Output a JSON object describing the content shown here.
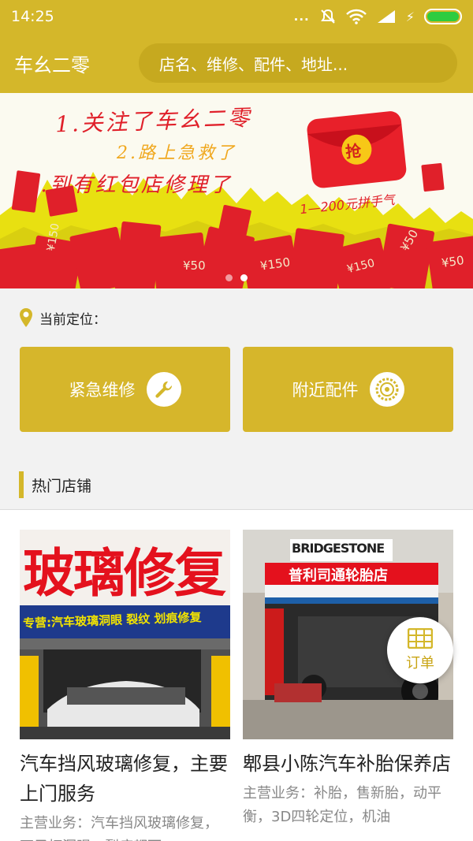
{
  "status_bar": {
    "time": "14:25",
    "dots": "..."
  },
  "header": {
    "title": "车幺二零",
    "search_placeholder": "店名、维修、配件、地址..."
  },
  "banner": {
    "lines": [
      "1.关注了车幺二零",
      "2.路上急救了",
      "3.到有红包店修理了"
    ],
    "envelope_text": "抢",
    "range_text": "1—200元拼手气",
    "envelope_labels": [
      "¥150",
      "¥50",
      "¥150",
      "¥50",
      "¥150",
      "¥50"
    ],
    "slides": 2,
    "active_slide": 1
  },
  "location": {
    "label": "当前定位："
  },
  "quick_actions": [
    {
      "label": "紧急维修",
      "icon": "wrench-icon"
    },
    {
      "label": "附近配件",
      "icon": "tire-icon"
    }
  ],
  "section": {
    "title": "热门店铺"
  },
  "shops": [
    {
      "name": "汽车挡风玻璃修复，主要上门服务",
      "desc": "主营业务：汽车挡风玻璃修复，石子打洞眼，裂痕都可",
      "sign_main": "玻璃修复",
      "sign_sub": "专营:汽车玻璃洞眼 裂纹 划痕修复"
    },
    {
      "name": "郫县小陈汽车补胎保养店",
      "desc": "主营业务：补胎，售新胎，动平衡，3D四轮定位，机油",
      "sign_brand": "BRIDGESTONE",
      "sign_store": "普利司通轮胎店"
    }
  ],
  "order_button": {
    "label": "订单"
  },
  "colors": {
    "accent": "#d4b72a",
    "button": "#d6b62b",
    "red": "#e0202a"
  }
}
